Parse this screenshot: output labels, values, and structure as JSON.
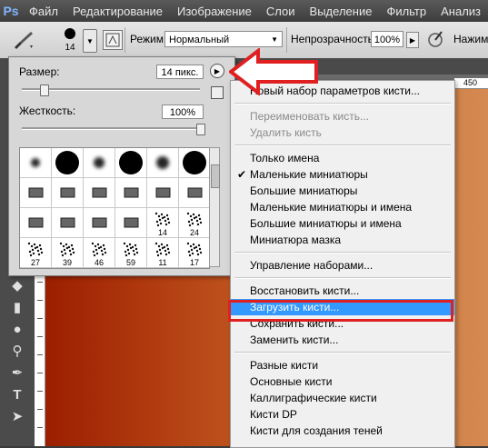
{
  "app_logo": "Ps",
  "menubar": [
    "Файл",
    "Редактирование",
    "Изображение",
    "Слои",
    "Выделение",
    "Фильтр",
    "Анализ"
  ],
  "options": {
    "brush_size": "14",
    "mode_label": "Режим:",
    "mode_value": "Нормальный",
    "opacity_label": "Непрозрачность:",
    "opacity_value": "100%",
    "push_label": "Нажим:"
  },
  "picker": {
    "size_label": "Размер:",
    "size_value": "14 пикс.",
    "size_level": 0.12,
    "hardness_label": "Жесткость:",
    "hardness_value": "100%",
    "hardness_level": 1.0,
    "brushes": [
      {
        "kind": "soft",
        "d": 10
      },
      {
        "kind": "hard",
        "d": 26
      },
      {
        "kind": "soft",
        "d": 12
      },
      {
        "kind": "hard",
        "d": 26
      },
      {
        "kind": "soft",
        "d": 14
      },
      {
        "kind": "hard",
        "d": 26
      },
      {
        "kind": "tip"
      },
      {
        "kind": "tip"
      },
      {
        "kind": "tip"
      },
      {
        "kind": "tip"
      },
      {
        "kind": "tip"
      },
      {
        "kind": "tip"
      },
      {
        "kind": "tip"
      },
      {
        "kind": "tip"
      },
      {
        "kind": "tip"
      },
      {
        "kind": "tip"
      },
      {
        "kind": "scatter",
        "num": "14"
      },
      {
        "kind": "scatter",
        "num": "24"
      },
      {
        "kind": "scatter",
        "num": "27"
      },
      {
        "kind": "scatter",
        "num": "39"
      },
      {
        "kind": "scatter",
        "num": "46"
      },
      {
        "kind": "scatter",
        "num": "59"
      },
      {
        "kind": "scatter",
        "num": "11"
      },
      {
        "kind": "scatter",
        "num": "17"
      }
    ]
  },
  "ruler_top_value": "450",
  "flyout_menu": [
    {
      "label": "Новый набор параметров кисти...",
      "state": "normal"
    },
    {
      "sep": true
    },
    {
      "label": "Переименовать кисть...",
      "state": "disabled"
    },
    {
      "label": "Удалить кисть",
      "state": "disabled"
    },
    {
      "sep": true
    },
    {
      "label": "Только имена",
      "state": "normal"
    },
    {
      "label": "Маленькие миниатюры",
      "state": "checked"
    },
    {
      "label": "Большие миниатюры",
      "state": "normal"
    },
    {
      "label": "Маленькие миниатюры и имена",
      "state": "normal"
    },
    {
      "label": "Большие миниатюры и имена",
      "state": "normal"
    },
    {
      "label": "Миниатюра мазка",
      "state": "normal"
    },
    {
      "sep": true
    },
    {
      "label": "Управление наборами...",
      "state": "normal"
    },
    {
      "sep": true
    },
    {
      "label": "Восстановить кисти...",
      "state": "normal"
    },
    {
      "label": "Загрузить кисти...",
      "state": "selected"
    },
    {
      "label": "Сохранить кисти...",
      "state": "normal"
    },
    {
      "label": "Заменить кисти...",
      "state": "normal"
    },
    {
      "sep": true
    },
    {
      "label": "Разные кисти",
      "state": "normal"
    },
    {
      "label": "Основные кисти",
      "state": "normal"
    },
    {
      "label": "Каллиграфические кисти",
      "state": "normal"
    },
    {
      "label": "Кисти DP",
      "state": "normal"
    },
    {
      "label": "Кисти для создания теней",
      "state": "normal"
    }
  ],
  "colors": {
    "accent": "#3399ff",
    "highlight_box": "#e02020",
    "arrow": "#e02020"
  }
}
